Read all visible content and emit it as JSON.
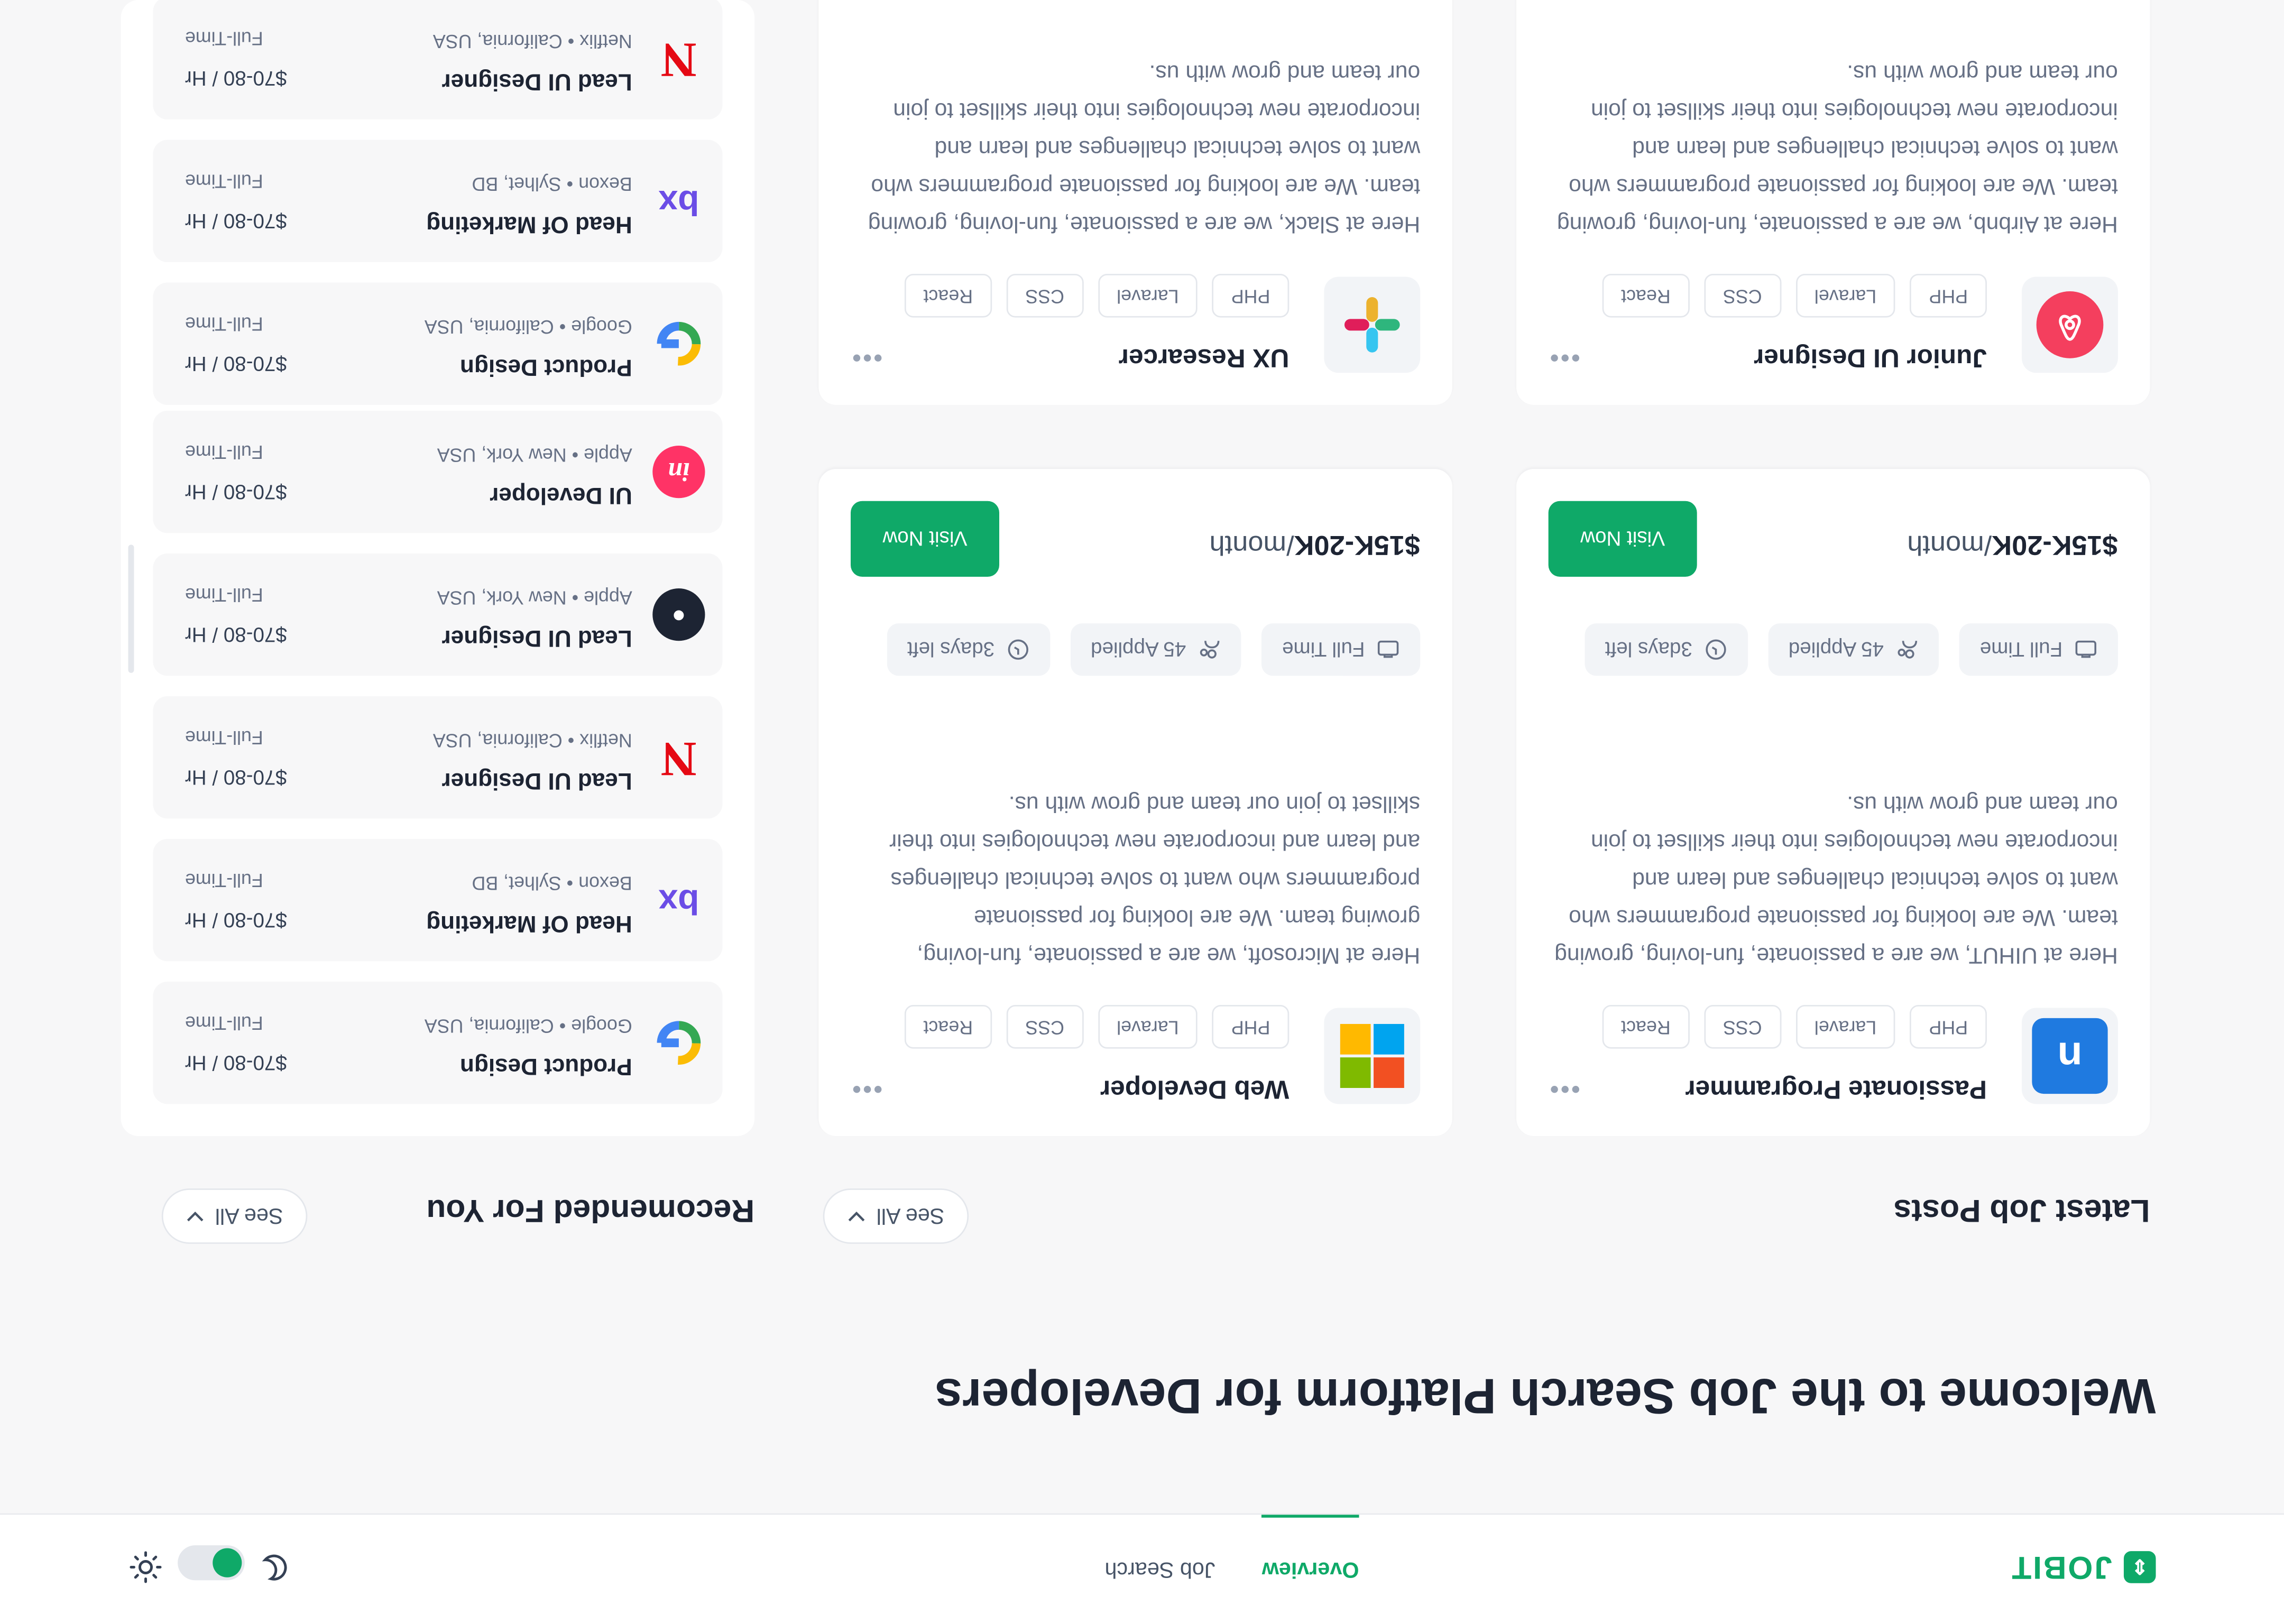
{
  "nav": {
    "logo_text": "JOBIT",
    "tabs": [
      "Overview",
      "Job Search"
    ]
  },
  "welcome": "Welcome to the Job Search Platform for Developers",
  "latest": {
    "title": "Latest Job Posts",
    "see_all": "See All",
    "cards": [
      {
        "company_icon": "uihut-logo",
        "title": "Passionate Programmer",
        "tags": [
          "PHP",
          "Laravel",
          "CSS",
          "React"
        ],
        "desc": "Here at UIHUT, we are a passionate, fun-loving, growing team. We are looking for passionate programmers who want to solve technical challenges and learn and incorporate new technologies into their skillset to join our team and grow with us.",
        "type": "Full Time",
        "applied": "45 Applied",
        "left": "3days left",
        "salary": "$15K-20K",
        "salary_unit": "/month",
        "visit": "Visit Now"
      },
      {
        "company_icon": "microsoft-logo",
        "title": "Web Developer",
        "tags": [
          "PHP",
          "Laravel",
          "CSS",
          "React"
        ],
        "desc": "Here at Microsoft, we are a passionate, fun-loving, growing team. We are looking for passionate programmers who want to solve technical challenges and learn and incorporate new technologies into their skillset to join our team and grow with us.",
        "type": "Full Time",
        "applied": "45 Applied",
        "left": "3days left",
        "salary": "$15K-20K",
        "salary_unit": "/month",
        "visit": "Visit Now"
      },
      {
        "company_icon": "airbnb-logo",
        "title": "Junior UI Designer",
        "tags": [
          "PHP",
          "Laravel",
          "CSS",
          "React"
        ],
        "desc": "Here at Airbnb, we are a passionate, fun-loving, growing team. We are looking for passionate programmers who want to solve technical challenges and learn and incorporate new technologies into their skillset to join our team and grow with us."
      },
      {
        "company_icon": "slack-logo",
        "title": "UX Researcer",
        "tags": [
          "PHP",
          "Laravel",
          "CSS",
          "React"
        ],
        "desc": "Here at Slack, we are a passionate, fun-loving, growing team. We are looking for passionate programmers who want to solve technical challenges and learn and incorporate new technologies into their skillset to join our team and grow with us."
      }
    ]
  },
  "recommended": {
    "title": "Recomended For You",
    "see_all": "See All",
    "items": [
      {
        "icon": "google-logo",
        "title": "Product Design",
        "company": "Google",
        "location": "California, USA",
        "salary": "$70-80 / Hr",
        "type": "Full-Time"
      },
      {
        "icon": "bexon-logo",
        "title": "Head Of Marketing",
        "company": "Bexon",
        "location": "Sylhet, BD",
        "salary": "$70-80 / Hr",
        "type": "Full-Time"
      },
      {
        "icon": "netflix-logo",
        "title": "Lead UI Designer",
        "company": "Netflix",
        "location": "California, USA",
        "salary": "$70-80 / Hr",
        "type": "Full-Time"
      },
      {
        "icon": "apple-logo",
        "title": "Lead UI Designer",
        "company": "Apple",
        "location": "New York, USA",
        "salary": "$70-80 / Hr",
        "type": "Full-Time"
      },
      {
        "icon": "invision-logo",
        "title": "UI Developer",
        "company": "Apple",
        "location": "New York, USA",
        "salary": "$70-80 / Hr",
        "type": "Full-Time"
      },
      {
        "icon": "google-logo",
        "title": "Product Design",
        "company": "Google",
        "location": "California, USA",
        "salary": "$70-80 / Hr",
        "type": "Full-Time"
      },
      {
        "icon": "bexon-logo",
        "title": "Head Of Marketing",
        "company": "Bexon",
        "location": "Sylhet, BD",
        "salary": "$70-80 / Hr",
        "type": "Full-Time"
      },
      {
        "icon": "netflix-logo",
        "title": "Lead UI Designer",
        "company": "Netflix",
        "location": "California, USA",
        "salary": "$70-80 / Hr",
        "type": "Full-Time"
      }
    ]
  },
  "colors": {
    "accent": "#0fa968",
    "netflix": "#e50914",
    "bexon": "#6b4de6",
    "invision": "#ff3366"
  }
}
